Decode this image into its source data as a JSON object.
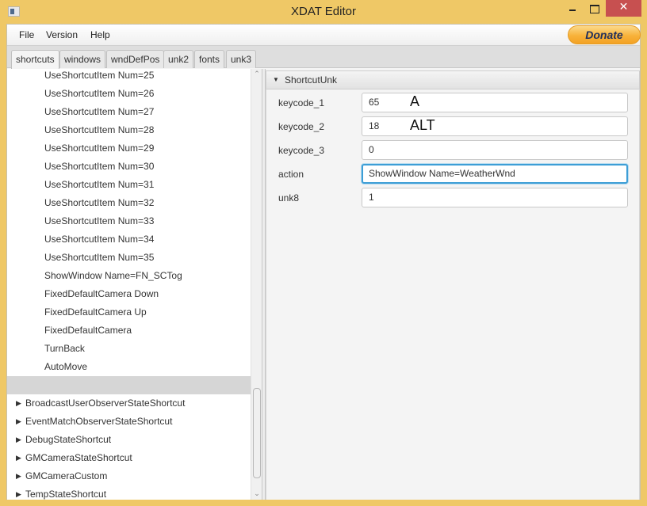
{
  "window": {
    "title": "XDAT Editor",
    "minimize_label": "",
    "maximize_label": "",
    "close_label": "✕"
  },
  "menubar": {
    "items": [
      {
        "label": "File"
      },
      {
        "label": "Version"
      },
      {
        "label": "Help"
      }
    ],
    "donate_label": "Donate"
  },
  "tabs": [
    {
      "label": "shortcuts",
      "active": true
    },
    {
      "label": "windows",
      "active": false
    },
    {
      "label": "wndDefPos",
      "active": false
    },
    {
      "label": "unk2",
      "active": false
    },
    {
      "label": "fonts",
      "active": false
    },
    {
      "label": "unk3",
      "active": false
    }
  ],
  "tree": {
    "leaf_items": [
      "UseShortcutItem Num=25",
      "UseShortcutItem Num=26",
      "UseShortcutItem Num=27",
      "UseShortcutItem Num=28",
      "UseShortcutItem Num=29",
      "UseShortcutItem Num=30",
      "UseShortcutItem Num=31",
      "UseShortcutItem Num=32",
      "UseShortcutItem Num=33",
      "UseShortcutItem Num=34",
      "UseShortcutItem Num=35",
      "ShowWindow Name=FN_SCTog",
      "FixedDefaultCamera Down",
      "FixedDefaultCamera Up",
      "FixedDefaultCamera",
      "TurnBack",
      "AutoMove",
      ""
    ],
    "selected_index": 17,
    "branch_items": [
      "BroadcastUserObserverStateShortcut",
      "EventMatchObserverStateShortcut",
      "DebugStateShortcut",
      "GMCameraStateShortcut",
      "GMCameraCustom",
      "TempStateShortcut"
    ],
    "expand_glyph": "▶",
    "scroll_up_glyph": "⌃",
    "scroll_down_glyph": "⌄"
  },
  "properties": {
    "section_title": "ShortcutUnk",
    "collapse_glyph": "▼",
    "fields": [
      {
        "label": "keycode_1",
        "value": "65",
        "hint": "A"
      },
      {
        "label": "keycode_2",
        "value": "18",
        "hint": "ALT"
      },
      {
        "label": "keycode_3",
        "value": "0",
        "hint": ""
      },
      {
        "label": "action",
        "value": "ShowWindow Name=WeatherWnd",
        "hint": ""
      },
      {
        "label": "unk8",
        "value": "1",
        "hint": ""
      }
    ],
    "focused_field": "action"
  },
  "colors": {
    "window_frame": "#efc866",
    "close_button": "#c75050",
    "focus_ring": "#3d9ed6",
    "selection": "#d6d6d6",
    "donate_bg": "#f8b23a",
    "donate_text": "#1f2e5d"
  }
}
